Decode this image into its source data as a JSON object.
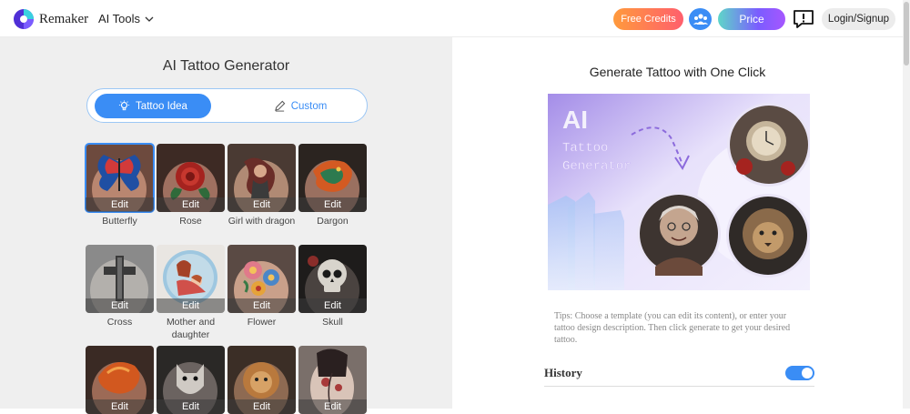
{
  "header": {
    "brand": "Remaker",
    "tools_menu": "AI Tools",
    "free_credits": "Free Credits",
    "price": "Price",
    "login": "Login/Signup"
  },
  "left": {
    "title": "AI Tattoo Generator",
    "tab_idea": "Tattoo Idea",
    "tab_custom": "Custom",
    "edit_label": "Edit",
    "templates": [
      {
        "label": "Butterfly",
        "selected": true
      },
      {
        "label": "Rose"
      },
      {
        "label": "Girl with dragon"
      },
      {
        "label": "Dargon"
      },
      {
        "label": "Cross"
      },
      {
        "label": "Mother and daughter"
      },
      {
        "label": "Flower"
      },
      {
        "label": "Skull"
      },
      {
        "label": ""
      },
      {
        "label": ""
      },
      {
        "label": ""
      },
      {
        "label": ""
      }
    ]
  },
  "right": {
    "title": "Generate Tattoo with One Click",
    "hero_line1": "AI",
    "hero_line2": "Tattoo",
    "hero_line3": "Generator",
    "tips": "Tips: Choose a template (you can edit its content), or enter your tattoo design description. Then click generate to get your desired tattoo.",
    "history_label": "History",
    "history_enabled": true
  },
  "colors": {
    "accent": "#3a8df5",
    "left_bg": "#efefef"
  }
}
